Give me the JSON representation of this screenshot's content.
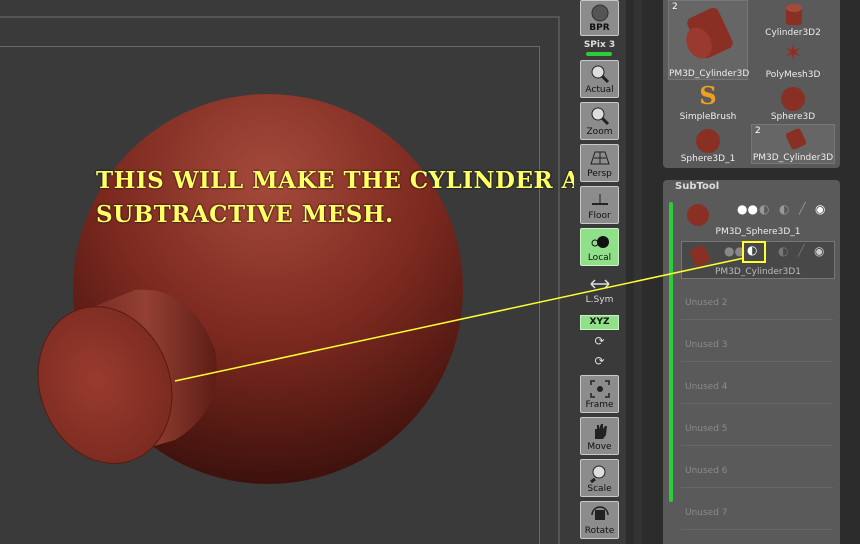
{
  "annotation": {
    "line1": "THIS WILL MAKE THE CYLINDER A",
    "line2": "SUBTRACTIVE MESH."
  },
  "colors": {
    "annotation": "#ffff66",
    "active_green": "#8fe089",
    "subtool_bar": "#2fcc3a",
    "mesh": "#8a2f24"
  },
  "shelf": {
    "bpr": "BPR",
    "spix": "SPix 3",
    "actual": "Actual",
    "zoom": "Zoom",
    "persp": "Persp",
    "floor": "Floor",
    "local": "Local",
    "lsym": "L.Sym",
    "xyz": "XYZ",
    "frame": "Frame",
    "move": "Move",
    "scale": "Scale",
    "rotate": "Rotate"
  },
  "tool_palette": {
    "items": [
      {
        "label": "PM3D_Cylinder3D",
        "count": "2"
      },
      {
        "label": "Cylinder3D2",
        "count": ""
      },
      {
        "label": "PolyMesh3D",
        "count": ""
      },
      {
        "label": "SimpleBrush",
        "count": ""
      },
      {
        "label": "Sphere3D",
        "count": ""
      },
      {
        "label": "Sphere3D_1",
        "count": ""
      },
      {
        "label": "PM3D_Cylinder3D",
        "count": "2"
      }
    ]
  },
  "subtool": {
    "title": "SubTool",
    "items": [
      {
        "name": "PM3D_Sphere3D_1"
      },
      {
        "name": "PM3D_Cylinder3D1"
      }
    ],
    "unused": [
      "Unused 2",
      "Unused 3",
      "Unused 4",
      "Unused 5",
      "Unused 6",
      "Unused 7"
    ]
  }
}
